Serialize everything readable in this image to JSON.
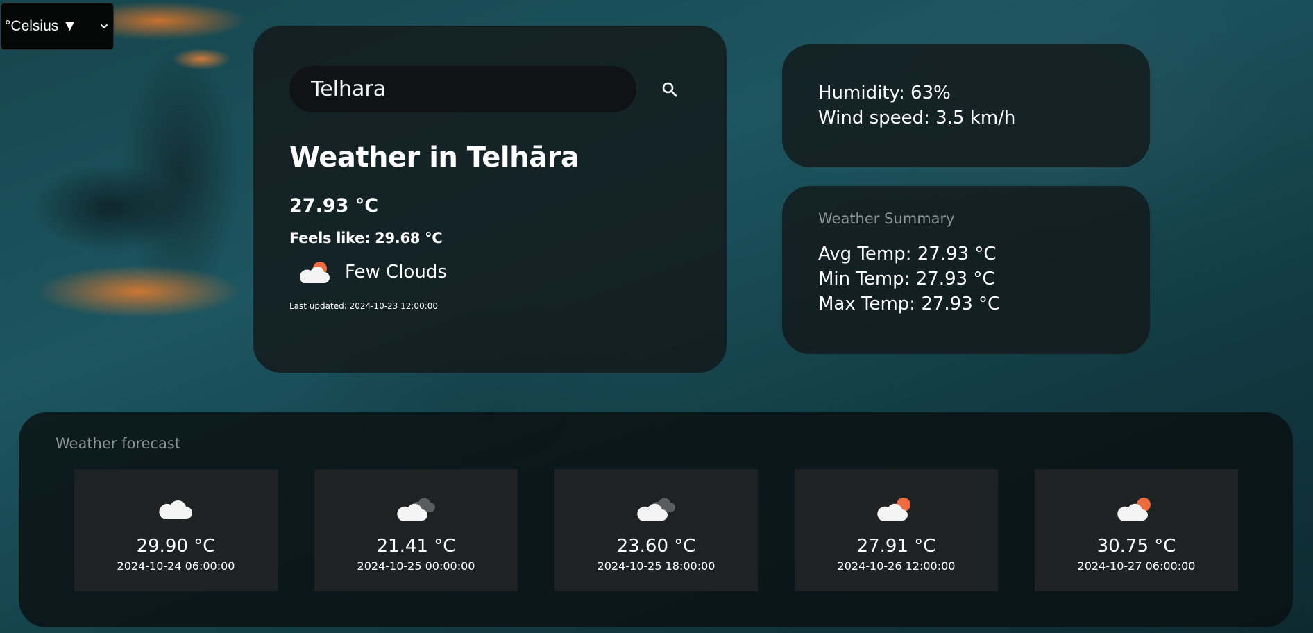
{
  "units": {
    "selected": "°Celsius ▼",
    "icon": "chevron-down-icon"
  },
  "search": {
    "value": "Telhara",
    "icon": "search-icon"
  },
  "current": {
    "title": "Weather in Telhāra",
    "temperature": "27.93 °C",
    "feels_like": "Feels like: 29.68 °C",
    "condition": "Few Clouds",
    "condition_icon": "partly-cloudy-day-icon",
    "last_updated": "Last updated: 2024-10-23 12:00:00"
  },
  "stats": {
    "humidity": "Humidity: 63%",
    "wind": "Wind speed: 3.5 km/h"
  },
  "summary": {
    "heading": "Weather Summary",
    "avg": "Avg Temp: 27.93 °C",
    "min": "Min Temp: 27.93 °C",
    "max": "Max Temp: 27.93 °C"
  },
  "forecast": {
    "heading": "Weather forecast",
    "items": [
      {
        "temp": "29.90 °C",
        "date": "2024-10-24 06:00:00",
        "icon": "cloud-icon"
      },
      {
        "temp": "21.41 °C",
        "date": "2024-10-25 00:00:00",
        "icon": "broken-clouds-icon"
      },
      {
        "temp": "23.60 °C",
        "date": "2024-10-25 18:00:00",
        "icon": "broken-clouds-icon"
      },
      {
        "temp": "27.91 °C",
        "date": "2024-10-26 12:00:00",
        "icon": "partly-cloudy-day-icon"
      },
      {
        "temp": "30.75 °C",
        "date": "2024-10-27 06:00:00",
        "icon": "partly-cloudy-day-icon"
      }
    ]
  },
  "colors": {
    "card_bg": "#121617",
    "input_bg": "#101213",
    "muted_text": "#8f9496",
    "sun": "#ee6a3f",
    "cloud": "#f2f2f2",
    "dark_cloud": "#5a5d60"
  }
}
